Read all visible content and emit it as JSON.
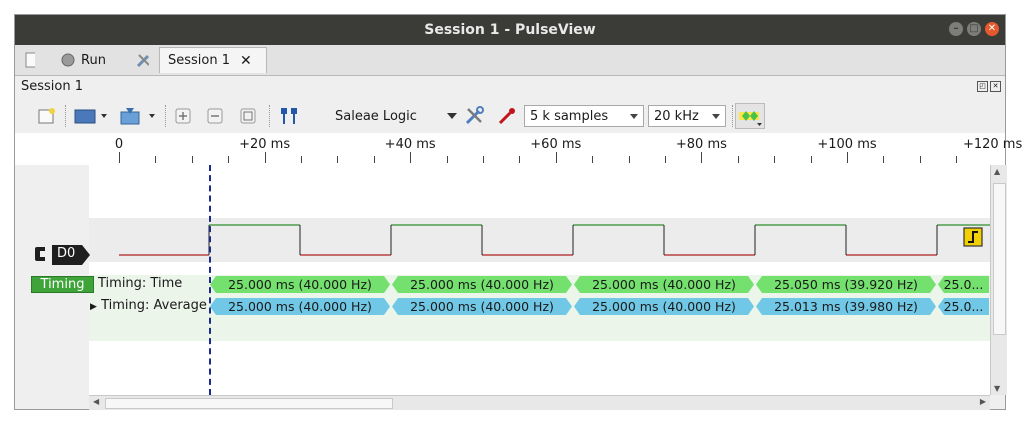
{
  "window": {
    "title": "Session 1 - PulseView"
  },
  "tabs": {
    "run_label": "Run",
    "session_tab_label": "Session 1",
    "close_glyph": "✕"
  },
  "session_label": "Session 1",
  "toolbar": {
    "device": "Saleae Logic",
    "samples": "5 k samples",
    "samplerate": "20 kHz"
  },
  "ruler": {
    "ticks": [
      "0",
      "+20 ms",
      "+40 ms",
      "+60 ms",
      "+80 ms",
      "+100 ms",
      "+120 ms"
    ]
  },
  "channels": {
    "d0_label": "D0",
    "timing_label": "Timing",
    "timing_time_label": "Timing: Time",
    "timing_average_label": "Timing: Average"
  },
  "decoder_rows": {
    "time": [
      "25.000 ms (40.000 Hz)",
      "25.000 ms (40.000 Hz)",
      "25.000 ms (40.000 Hz)",
      "25.050 ms (39.920 Hz)",
      "25.0..."
    ],
    "average": [
      "25.000 ms (40.000 Hz)",
      "25.000 ms (40.000 Hz)",
      "25.000 ms (40.000 Hz)",
      "25.013 ms (39.980 Hz)",
      "25.0..."
    ]
  },
  "colors": {
    "titlebar": "#3b3b38",
    "decoder_green": "#74e06e",
    "decoder_blue": "#71c8e6",
    "trace_high": "#2e8b2e",
    "trace_low": "#b02020",
    "cursor": "#1a2b8c",
    "timing_badge": "#3ea43a",
    "trigger_badge": "#f0d000"
  },
  "icons": [
    "new-document-icon",
    "run-icon",
    "settings-icon",
    "close-icon",
    "open-file-icon",
    "save-icon",
    "zoom-in-icon",
    "zoom-out-icon",
    "zoom-fit-icon",
    "cursor-markers-icon",
    "device-config-icon",
    "probe-icon",
    "decoder-icon",
    "trigger-edge-icon",
    "channel-icon"
  ]
}
